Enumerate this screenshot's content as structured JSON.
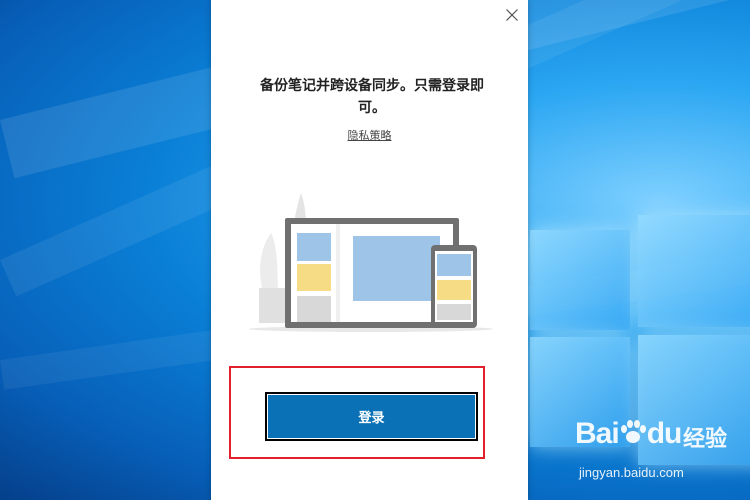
{
  "dialog": {
    "heading": "备份笔记并跨设备同步。只需登录即可。",
    "privacy_link": "隐私策略",
    "signin_button": "登录",
    "close_icon": "close-icon",
    "illustration": "laptop-and-phone-illustration"
  },
  "watermark": {
    "brand": "Bai",
    "brand_suffix": "du",
    "cn": "经验",
    "url": "jingyan.baidu.com"
  },
  "colors": {
    "accent": "#0b71b6",
    "highlight": "#e0202a",
    "desktop": "#0a7fd6"
  }
}
